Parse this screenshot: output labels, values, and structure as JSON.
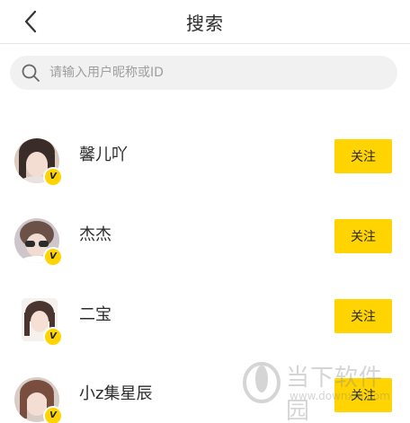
{
  "header": {
    "title": "搜索",
    "back_icon": "chevron-left-icon"
  },
  "search": {
    "placeholder": "请输入用户昵称或ID",
    "value": "",
    "icon": "search-icon"
  },
  "users": [
    {
      "name": "馨儿吖",
      "follow_label": "关注",
      "badge": "V"
    },
    {
      "name": "杰杰",
      "follow_label": "关注",
      "badge": "V"
    },
    {
      "name": "二宝",
      "follow_label": "关注",
      "badge": "V"
    },
    {
      "name": "小z集星辰",
      "follow_label": "关注",
      "badge": "V"
    }
  ],
  "watermark": {
    "text": "当下软件园",
    "url": "www.downxia.com"
  },
  "colors": {
    "accent": "#ffd400",
    "search_bg": "#f1f1f1",
    "divider": "#e6e6e6",
    "text_primary": "#2b2b2b",
    "placeholder": "#9e9e9e"
  }
}
